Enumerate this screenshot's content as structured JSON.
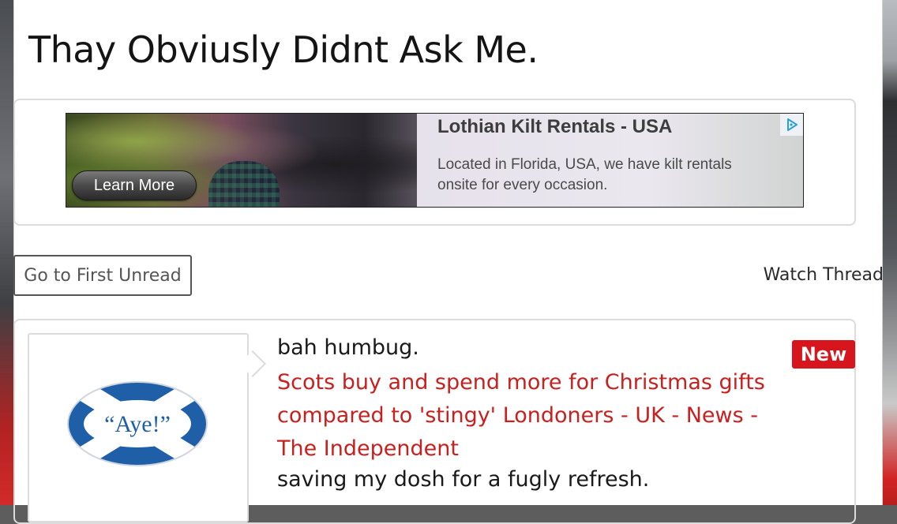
{
  "thread": {
    "title": "Thay Obviusly Didnt Ask Me."
  },
  "ad": {
    "headline": "Lothian Kilt Rentals - USA",
    "body": "Located in Florida, USA, we have kilt rentals onsite for every occasion.",
    "cta_label": "Learn More",
    "adchoices_icon": "adchoices-icon"
  },
  "toolbar": {
    "first_unread_label": "Go to First Unread",
    "watch_label": "Watch Thread"
  },
  "post": {
    "badge": "New",
    "avatar_text": "“Aye!”",
    "line1": "bah humbug.",
    "link_text": "Scots buy and spend more for Christmas gifts compared to 'stingy' Londoners - UK - News - The Independent",
    "line3": "saving my dosh for a fugly refresh."
  },
  "colors": {
    "link": "#c8201e",
    "badge": "#d6161c",
    "saltire_blue": "#1f5fa8"
  }
}
